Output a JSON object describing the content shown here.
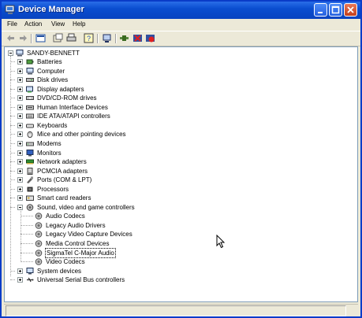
{
  "window": {
    "title": "Device Manager"
  },
  "menu": [
    "File",
    "Action",
    "View",
    "Help"
  ],
  "toolbar": [
    "back-icon",
    "forward-icon",
    "properties-icon",
    "refresh-icon",
    "print-icon",
    "help-icon",
    "scan-hardware-icon",
    "update-driver-icon",
    "uninstall-icon",
    "disable-icon"
  ],
  "tree": {
    "root": "SANDY-BENNETT",
    "categories": [
      {
        "label": "Batteries",
        "icon": "battery-icon",
        "expanded": false
      },
      {
        "label": "Computer",
        "icon": "computer-icon",
        "expanded": false
      },
      {
        "label": "Disk drives",
        "icon": "disk-drive-icon",
        "expanded": false
      },
      {
        "label": "Display adapters",
        "icon": "display-adapter-icon",
        "expanded": false
      },
      {
        "label": "DVD/CD-ROM drives",
        "icon": "cdrom-icon",
        "expanded": false
      },
      {
        "label": "Human Interface Devices",
        "icon": "hid-icon",
        "expanded": false
      },
      {
        "label": "IDE ATA/ATAPI controllers",
        "icon": "ide-icon",
        "expanded": false
      },
      {
        "label": "Keyboards",
        "icon": "keyboard-icon",
        "expanded": false
      },
      {
        "label": "Mice and other pointing devices",
        "icon": "mouse-icon",
        "expanded": false
      },
      {
        "label": "Modems",
        "icon": "modem-icon",
        "expanded": false
      },
      {
        "label": "Monitors",
        "icon": "monitor-icon",
        "expanded": false
      },
      {
        "label": "Network adapters",
        "icon": "network-adapter-icon",
        "expanded": false
      },
      {
        "label": "PCMCIA adapters",
        "icon": "pcmcia-icon",
        "expanded": false
      },
      {
        "label": "Ports (COM & LPT)",
        "icon": "port-icon",
        "expanded": false
      },
      {
        "label": "Processors",
        "icon": "processor-icon",
        "expanded": false
      },
      {
        "label": "Smart card readers",
        "icon": "smart-card-icon",
        "expanded": false
      },
      {
        "label": "Sound, video and game controllers",
        "icon": "speaker-icon",
        "expanded": true,
        "children": [
          {
            "label": "Audio Codecs",
            "selected": false
          },
          {
            "label": "Legacy Audio Drivers",
            "selected": false
          },
          {
            "label": "Legacy Video Capture Devices",
            "selected": false
          },
          {
            "label": "Media Control Devices",
            "selected": false
          },
          {
            "label": "SigmaTel C-Major Audio",
            "selected": true
          },
          {
            "label": "Video Codecs",
            "selected": false
          }
        ]
      },
      {
        "label": "System devices",
        "icon": "system-device-icon",
        "expanded": false
      },
      {
        "label": "Universal Serial Bus controllers",
        "icon": "usb-icon",
        "expanded": false
      }
    ]
  },
  "colors": {
    "title_bar": "#0a4ed0",
    "selection_outline": "#000000",
    "window_bg": "#ece9d8"
  }
}
